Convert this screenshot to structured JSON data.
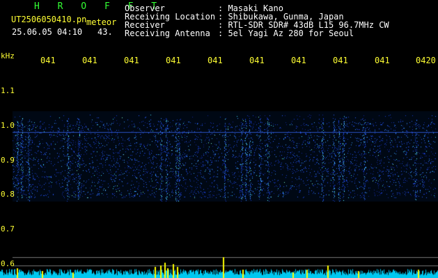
{
  "header": {
    "brand": "H R O F F T",
    "filename": "UT2506050410.pn",
    "mode": "meteor",
    "datetime": "25.06.05 04:10",
    "count": "43.",
    "fields": [
      {
        "label": "Observer",
        "value": ": Masaki Kano"
      },
      {
        "label": "Receiving Location",
        "value": ": Shibukawa, Gunma, Japan"
      },
      {
        "label": "Receiver",
        "value": ": RTL-SDR SDR# 43dB L15 96.7MHz CW"
      },
      {
        "label": "Receiving Antenna",
        "value": ": 5el Yagi Az 280 for Seoul"
      }
    ]
  },
  "axis": {
    "unit": "kHz",
    "y_labels": [
      "1.1",
      "1.0",
      "0.9",
      "0.8",
      "0.7",
      "0.6"
    ],
    "time_ticks": [
      "041",
      "041",
      "041",
      "041",
      "041",
      "041",
      "041",
      "041",
      "041",
      "0420"
    ]
  },
  "colors": {
    "background": "#000000",
    "text": "#ffffff",
    "axis": "#ffff33",
    "brand": "#33ff33",
    "noise_floor": "#00e5ff",
    "signal_spikes": "#ffff00"
  }
}
